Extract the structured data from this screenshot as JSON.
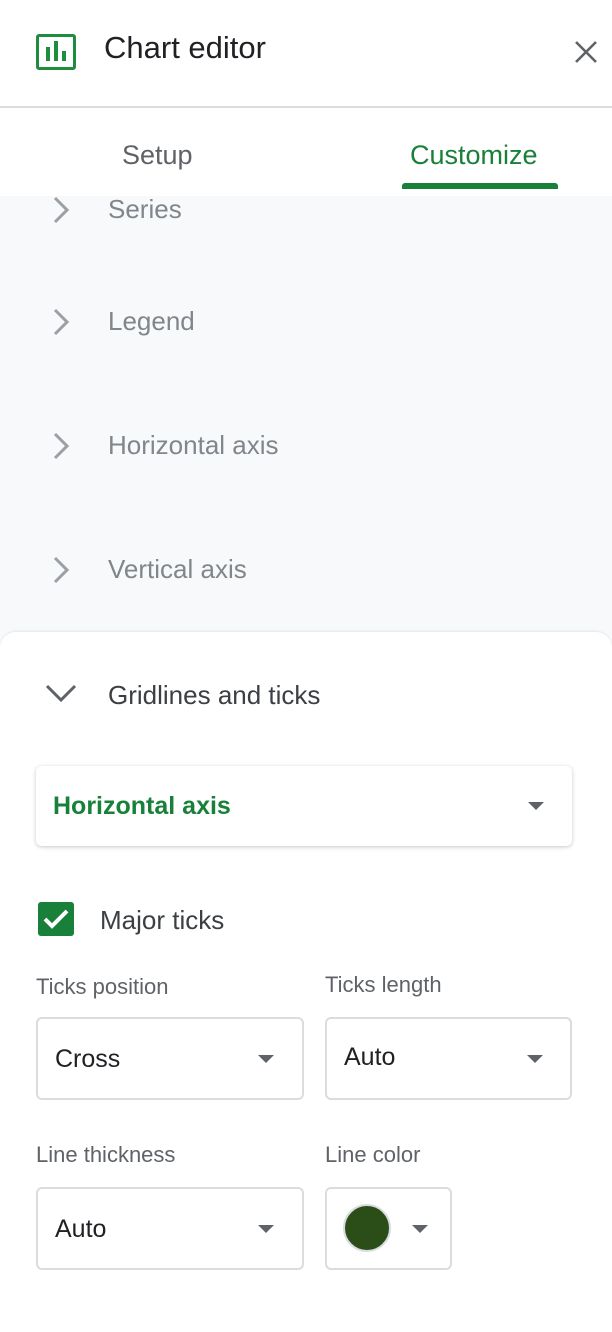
{
  "header": {
    "title": "Chart editor",
    "logo_icon": "chart-bar-icon",
    "close_icon": "close-icon"
  },
  "tabs": [
    {
      "label": "Setup",
      "active": false
    },
    {
      "label": "Customize",
      "active": true
    }
  ],
  "accordion": {
    "items": [
      {
        "label": "Series"
      },
      {
        "label": "Legend"
      },
      {
        "label": "Horizontal axis"
      },
      {
        "label": "Vertical axis"
      }
    ],
    "expanded": {
      "label": "Gridlines and ticks"
    }
  },
  "gridlines": {
    "axis_select": "Horizontal axis",
    "major_ticks": {
      "label": "Major ticks",
      "checked": true
    },
    "ticks_position": {
      "label": "Ticks position",
      "value": "Cross"
    },
    "ticks_length": {
      "label": "Ticks length",
      "value": "Auto"
    },
    "line_thickness": {
      "label": "Line thickness",
      "value": "Auto"
    },
    "line_color": {
      "label": "Line color",
      "value": "#2b4d17"
    }
  },
  "colors": {
    "accent": "#188038",
    "panel_bg": "#f8f9fa"
  }
}
